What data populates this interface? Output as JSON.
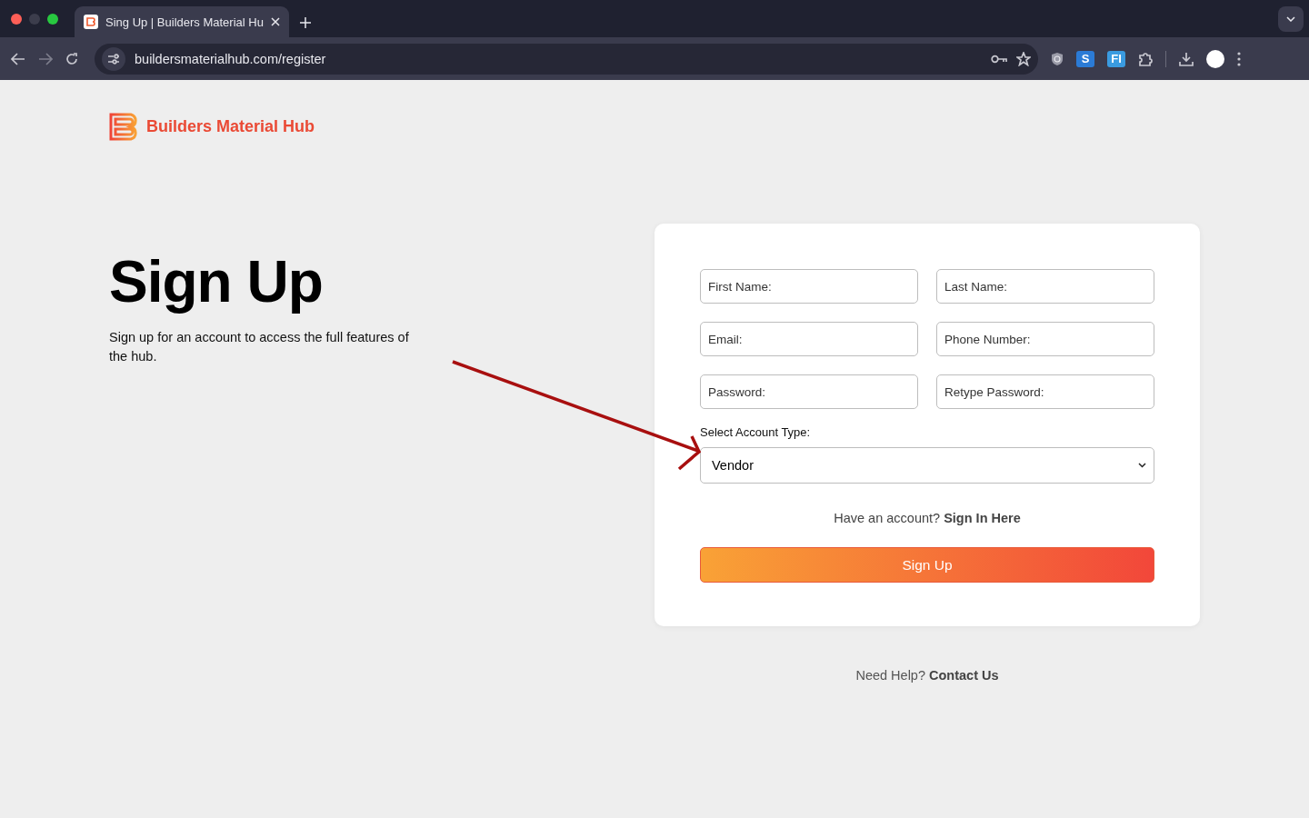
{
  "browser": {
    "tabs": [
      {
        "title": "Sing Up | Builders Material Hu",
        "selected": true
      }
    ],
    "address": "buildersmaterialhub.com/register",
    "extensions": [
      {
        "kind": "shield"
      },
      {
        "kind": "letter",
        "label": "S",
        "color": "#2b7bd6"
      },
      {
        "kind": "letter",
        "label": "FI",
        "color": "#3a9be0"
      },
      {
        "kind": "puzzle"
      }
    ]
  },
  "brand": {
    "name": "Builders Material Hub"
  },
  "intro": {
    "title": "Sign Up",
    "text": "Sign up for an account to access the full features of the hub."
  },
  "form": {
    "fields": [
      {
        "placeholder": "First Name:"
      },
      {
        "placeholder": "Last Name:"
      },
      {
        "placeholder": "Email:"
      },
      {
        "placeholder": "Phone Number:"
      },
      {
        "placeholder": "Password:"
      },
      {
        "placeholder": "Retype Password:"
      }
    ],
    "account_type": {
      "label": "Select Account Type:",
      "value": "Vendor"
    },
    "sign_in": {
      "prompt": "Have an account?",
      "link": "Sign In Here"
    },
    "submit": "Sign Up"
  },
  "help": {
    "prompt": "Need Help?",
    "link": "Contact Us"
  },
  "annotations": [
    {
      "kind": "arrow"
    }
  ]
}
